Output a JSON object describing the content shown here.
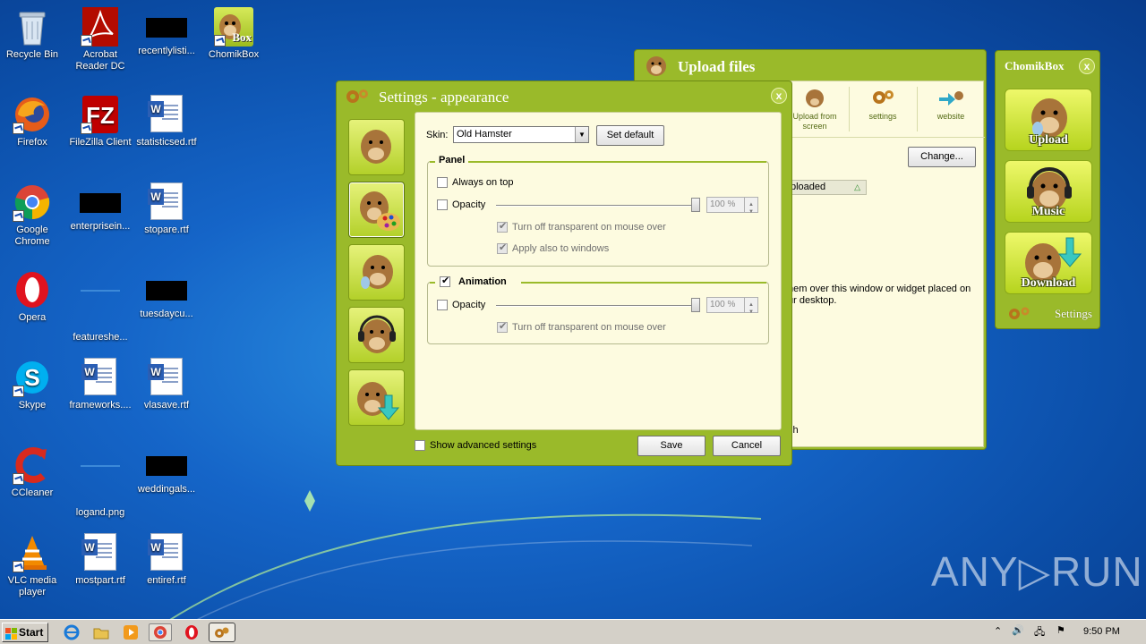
{
  "desktop": {
    "icons": [
      {
        "label": "Recycle Bin"
      },
      {
        "label": "Acrobat Reader DC"
      },
      {
        "label": "recentlylisti..."
      },
      {
        "label": "ChomikBox"
      },
      {
        "label": "Firefox"
      },
      {
        "label": "FileZilla Client"
      },
      {
        "label": "statisticsed.rtf"
      },
      {
        "label": "Google Chrome"
      },
      {
        "label": "enterprisein..."
      },
      {
        "label": "stopare.rtf"
      },
      {
        "label": "Opera"
      },
      {
        "label": "featureshe..."
      },
      {
        "label": "tuesdaycu..."
      },
      {
        "label": "Skype"
      },
      {
        "label": "frameworks...."
      },
      {
        "label": "vlasave.rtf"
      },
      {
        "label": "CCleaner"
      },
      {
        "label": "logand.png"
      },
      {
        "label": "weddingals..."
      },
      {
        "label": "VLC media player"
      },
      {
        "label": "mostpart.rtf"
      },
      {
        "label": "entiref.rtf"
      }
    ],
    "chomikbox_badge": "Box",
    "watermark": "ANY▷RUN"
  },
  "upload_window": {
    "title": "Upload files",
    "toolbar": [
      "Upload from screen",
      "settings",
      "website"
    ],
    "change_button": "Change...",
    "column_header": "ploaded",
    "hint_line1": "hem over this window or widget placed on",
    "hint_line2": "ur desktop.",
    "footer_fragment": "sh"
  },
  "widget": {
    "title": "ChomikBox",
    "buttons": [
      "Upload",
      "Music",
      "Download"
    ],
    "settings_label": "Settings",
    "close": "x"
  },
  "settings": {
    "title": "Settings - appearance",
    "close": "x",
    "skin_label": "Skin:",
    "skin_value": "Old Hamster",
    "set_default_button": "Set default",
    "panel_group": {
      "title": "Panel",
      "always_on_top": "Always on top",
      "opacity": "Opacity",
      "opacity_value": "100 %",
      "turn_off_transparent": "Turn off transparent on mouse over",
      "apply_windows": "Apply also to windows"
    },
    "animation_group": {
      "title": "Animation",
      "opacity": "Opacity",
      "opacity_value": "100 %",
      "turn_off_transparent": "Turn off transparent on mouse over"
    },
    "show_advanced": "Show advanced settings",
    "save_button": "Save",
    "cancel_button": "Cancel"
  },
  "taskbar": {
    "start": "Start",
    "clock": "9:50 PM"
  }
}
